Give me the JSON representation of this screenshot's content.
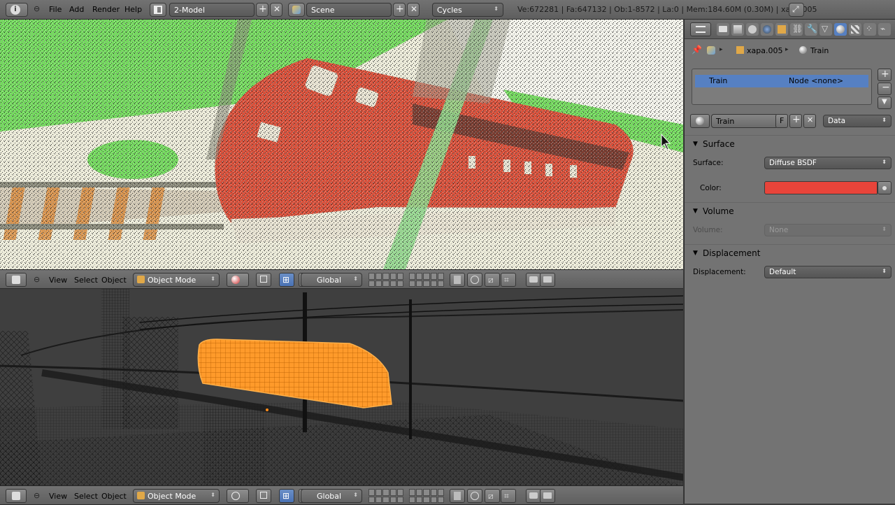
{
  "topbar": {
    "menus": [
      "File",
      "Add",
      "Render",
      "Help"
    ],
    "layout_name": "2-Model",
    "scene_name": "Scene",
    "render_engine": "Cycles",
    "stats": "Ve:672281 | Fa:647132 | Ob:1-8572 | La:0 | Mem:184.60M (0.30M) | xapa.005"
  },
  "viewport_top": {
    "menus": [
      "View",
      "Select",
      "Object"
    ],
    "mode": "Object Mode",
    "orientation": "Global"
  },
  "viewport_bottom": {
    "menus": [
      "View",
      "Select",
      "Object"
    ],
    "mode": "Object Mode",
    "orientation": "Global"
  },
  "properties": {
    "breadcrumb": {
      "object": "xapa.005",
      "material": "Train"
    },
    "material_slot": {
      "name": "Train",
      "node": "Node <none>"
    },
    "material_datablock": {
      "name": "Train",
      "fake_user": "F",
      "link": "Data"
    },
    "sections": {
      "surface": {
        "title": "Surface",
        "surface_label": "Surface:",
        "surface_value": "Diffuse BSDF",
        "color_label": "Color:",
        "color_value": "#e8443a"
      },
      "volume": {
        "title": "Volume",
        "volume_label": "Volume:",
        "volume_value": "None"
      },
      "displacement": {
        "title": "Displacement",
        "displacement_label": "Displacement:",
        "displacement_value": "Default"
      }
    }
  },
  "colors": {
    "accent": "#5680c2",
    "selected_wire": "#ff8c1a",
    "train_render": "#d9503a",
    "grass": "#6dd85a"
  }
}
